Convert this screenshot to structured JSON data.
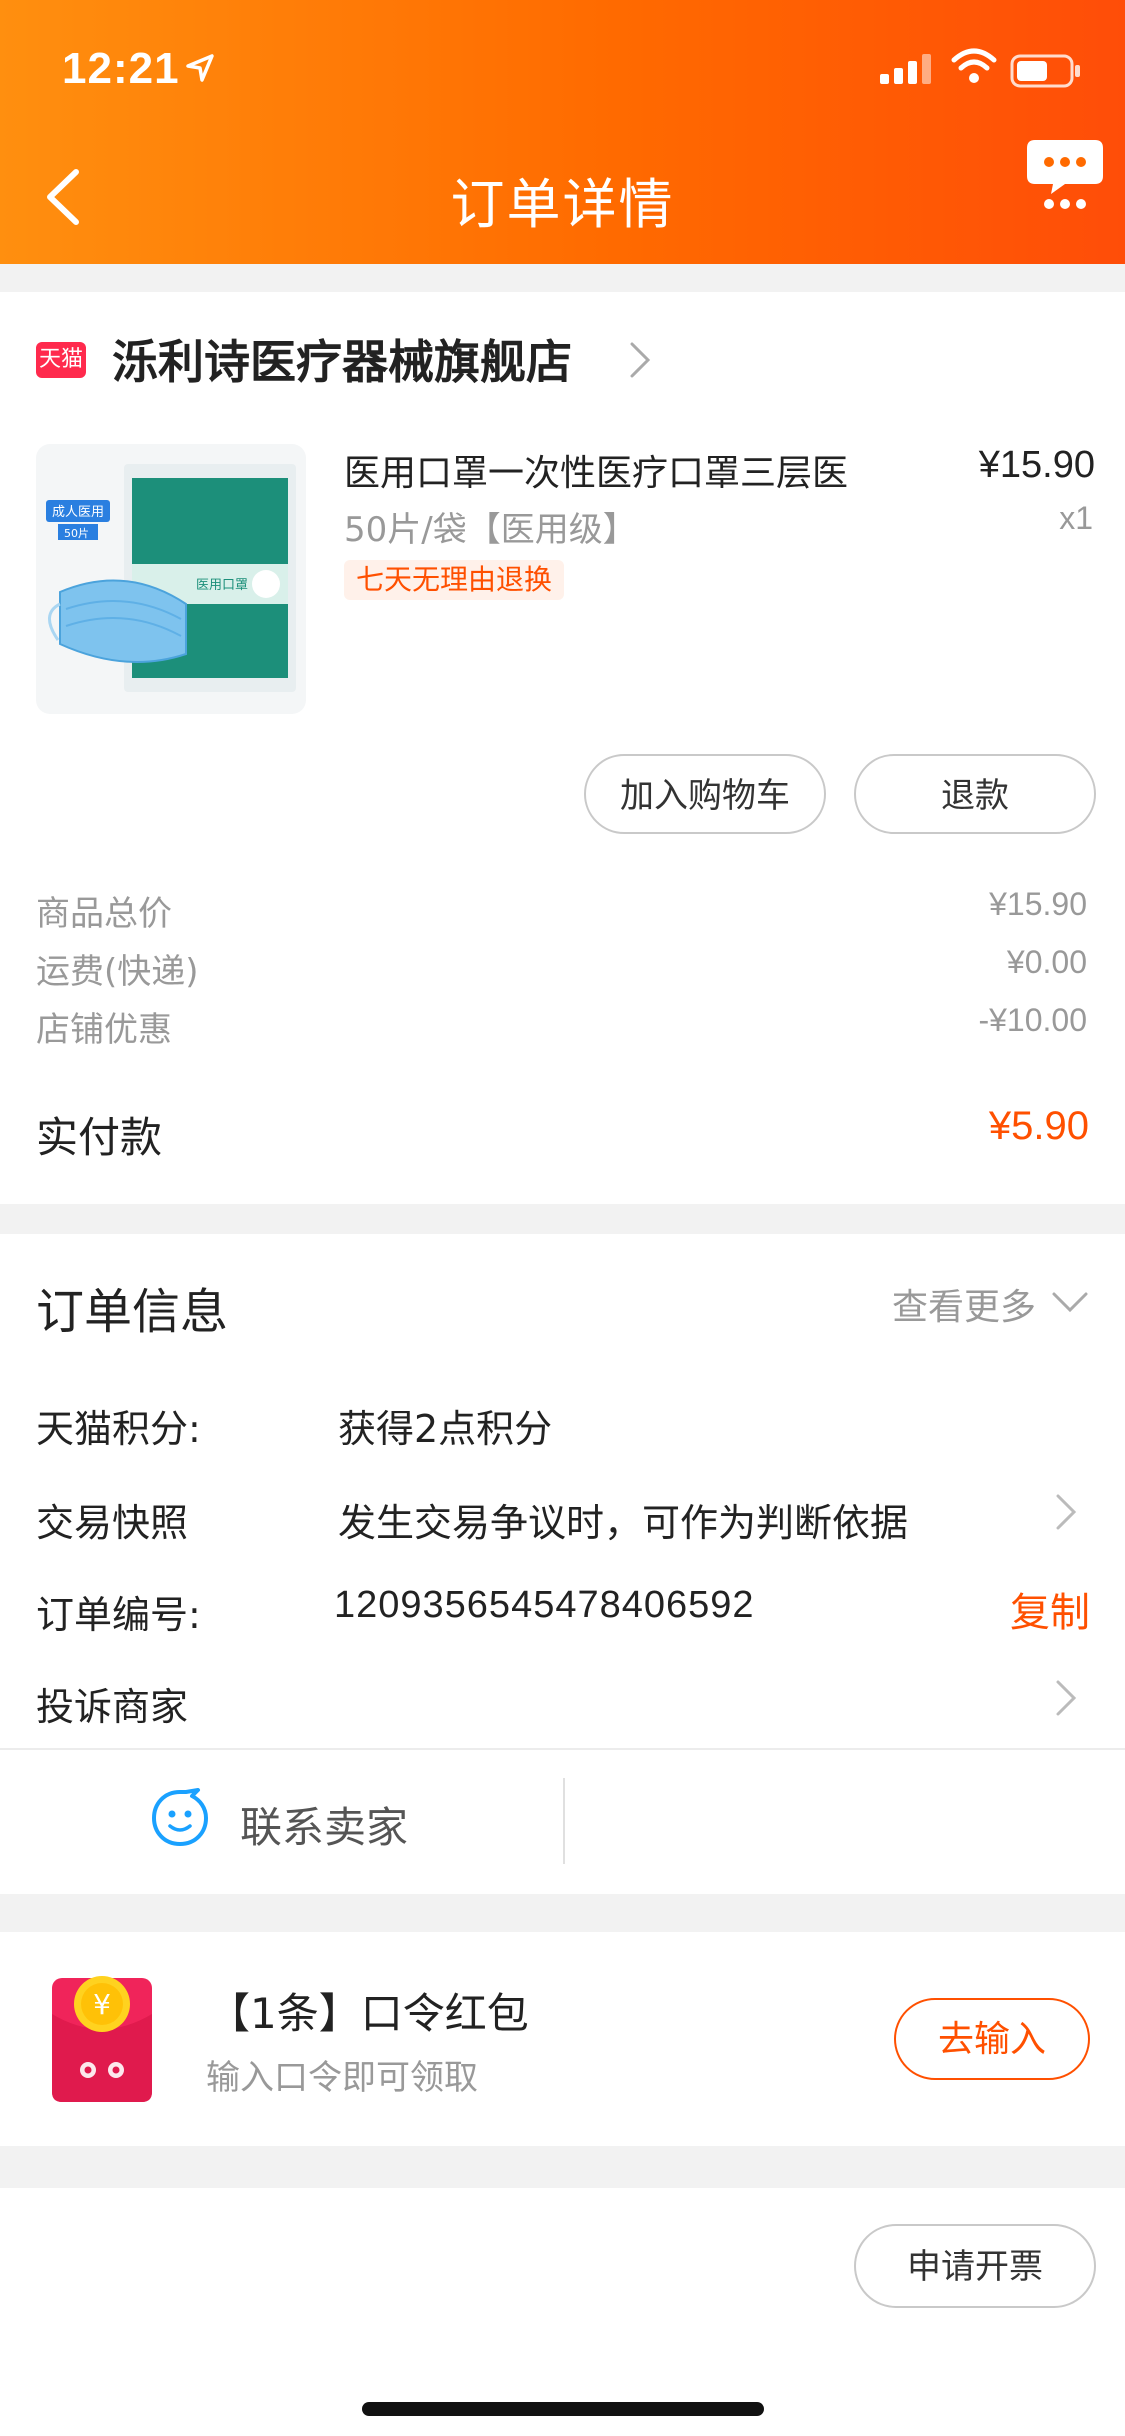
{
  "status_bar": {
    "time": "12:21"
  },
  "header": {
    "title": "订单详情"
  },
  "shop": {
    "badge": "天猫",
    "name": "泺利诗医疗器械旗舰店",
    "product": {
      "title": "医用口罩一次性医疗口罩三层医",
      "sku": "50片/袋【医用级】",
      "tag": "七天无理由退换",
      "price": "¥15.90",
      "qty": "x1",
      "img_badge": "成人医用",
      "img_badge2": "50片",
      "img_label": "医用口罩"
    },
    "buttons": {
      "cart": "加入购物车",
      "refund": "退款"
    },
    "fees": [
      {
        "label": "商品总价",
        "value": "¥15.90"
      },
      {
        "label": "运费(快递)",
        "value": "¥0.00"
      },
      {
        "label": "店铺优惠",
        "value": "-¥10.00"
      }
    ],
    "payment": {
      "label": "实付款",
      "value": "¥5.90"
    }
  },
  "order_info": {
    "title": "订单信息",
    "see_more": "查看更多",
    "rows": [
      {
        "label": "天猫积分:",
        "value": "获得2点积分"
      },
      {
        "label": "交易快照",
        "value": "发生交易争议时，可作为判断依据"
      },
      {
        "label": "订单编号:",
        "value": "1209356545478406592"
      },
      {
        "label": "投诉商家",
        "value": ""
      }
    ],
    "copy_label": "复制",
    "contact_label": "联系卖家"
  },
  "red_packet": {
    "title": "【1条】口令红包",
    "subtitle": "输入口令即可领取",
    "button": "去输入"
  },
  "bottom": {
    "invoice_button": "申请开票"
  },
  "colors": {
    "accent": "#ff5000",
    "header_start": "#ff8f0f",
    "header_end": "#ff4d08"
  }
}
